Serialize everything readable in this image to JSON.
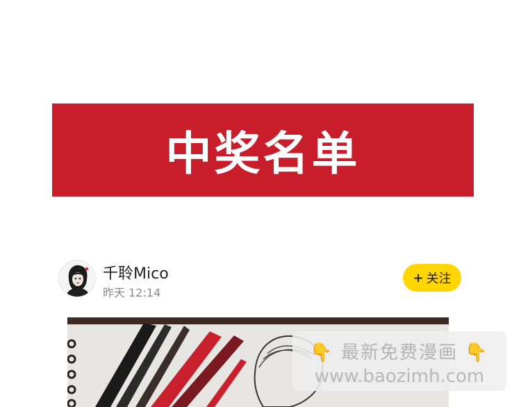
{
  "banner": {
    "title": "中奖名单"
  },
  "post": {
    "username": "千聆Mico",
    "time": "昨天 12:14",
    "follow_plus": "+",
    "follow_label": "关注"
  },
  "watermark": {
    "left_icon": "👇",
    "title": "最新免费漫画",
    "right_icon": "👇",
    "url": "www.baozimh.com"
  },
  "colors": {
    "banner_red": "#c81e2b",
    "follow_yellow": "#ffd600"
  },
  "icons": [
    "avatar-image",
    "pointing-down-hand-icon"
  ]
}
